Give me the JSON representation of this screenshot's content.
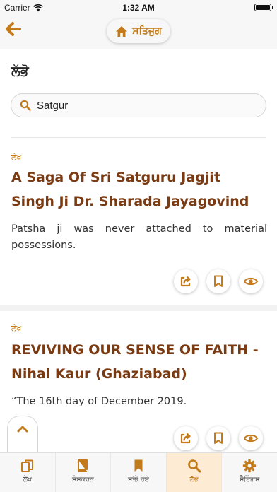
{
  "status_bar": {
    "carrier": "Carrier",
    "time": "1:32 AM"
  },
  "header": {
    "home_label": "ਸਤਿਜੁਗ"
  },
  "colors": {
    "accent": "#c27a1b",
    "title": "#7a3a12",
    "active_tab_bg": "#fdebd3"
  },
  "search": {
    "heading": "ਲੱਭੋ",
    "query": "Satgur"
  },
  "results": [
    {
      "category": "ਲੇਖ",
      "title": "A Saga Of Sri Satguru Jagjit Singh Ji Dr. Sharada Jayagovind",
      "excerpt": "Patsha ji was never attached to material possessions.",
      "actions": [
        "share-icon",
        "bookmark-icon",
        "view-icon"
      ]
    },
    {
      "category": "ਲੇਖ",
      "title": "REVIVING OUR SENSE OF FAITH - Nihal Kaur (Ghaziabad)",
      "excerpt": "“The 16th day of December 2019.",
      "actions": [
        "share-icon",
        "bookmark-icon",
        "view-icon"
      ]
    }
  ],
  "tabs": [
    {
      "label": "ਲੇਖ",
      "icon": "articles-icon",
      "active": false
    },
    {
      "label": "ਸੰਸਕਰਨ",
      "icon": "book-icon",
      "active": false
    },
    {
      "label": "ਸਾਂਭੇ ਹੋਏ",
      "icon": "bookmark-icon",
      "active": false
    },
    {
      "label": "ਲੱਭੋ",
      "icon": "search-icon",
      "active": true
    },
    {
      "label": "ਸੈਟਿੰਗਸ",
      "icon": "gear-icon",
      "active": false
    }
  ]
}
